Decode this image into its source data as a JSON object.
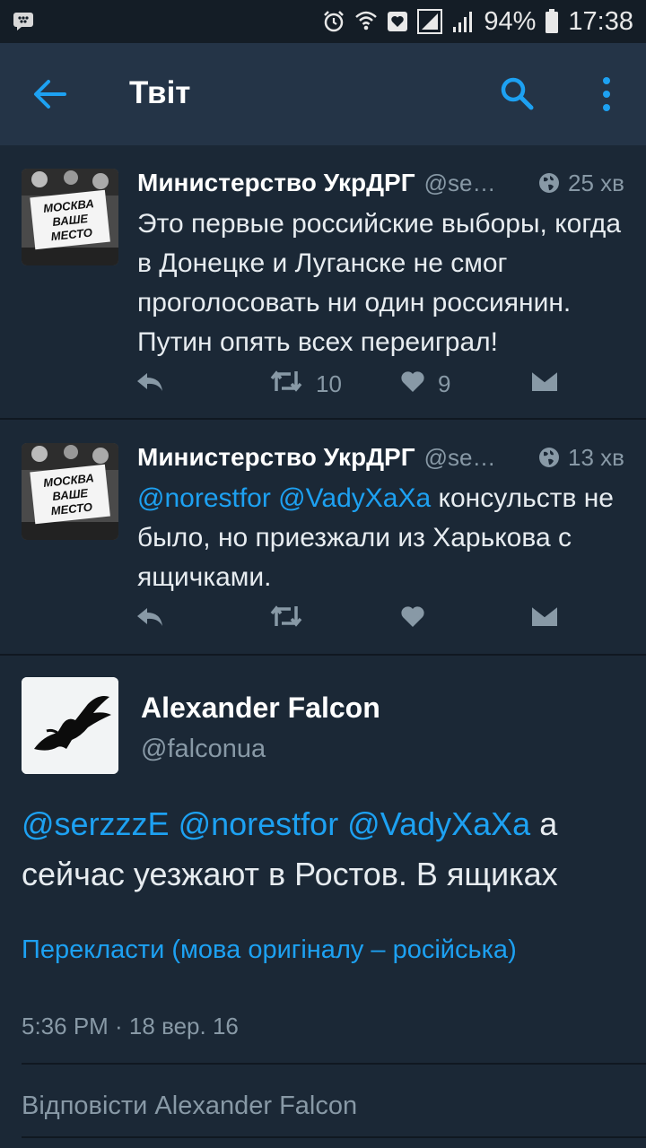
{
  "status_bar": {
    "battery": "94%",
    "time": "17:38",
    "icons": [
      "blackberry-messenger-icon",
      "alarm-icon",
      "wifi-icon",
      "heart-icon",
      "signal-icon",
      "signal-icon",
      "battery-icon"
    ]
  },
  "app_bar": {
    "title": "Твіт",
    "icons": [
      "back-arrow-icon",
      "search-icon",
      "more-vert-icon"
    ]
  },
  "tweets": [
    {
      "name": "Министерство УкрДРГ",
      "handle": "@se…",
      "time": "25 хв",
      "text": "Это первые российские выборы, когда в Донецке и Луганске не смог проголосовать ни один россиянин. Путин опять всех переиграл!",
      "retweets": "10",
      "likes": "9",
      "avatar_sign": [
        "МОСКВА",
        "ВАШЕ",
        "МЕСТО"
      ]
    },
    {
      "name": "Министерство УкрДРГ",
      "handle": "@se…",
      "time": "13 хв",
      "mentions": "@norestfor @VadyXaXa",
      "text": " консульств не было, но приезжали из Харькова с ящичками.",
      "retweets": "",
      "likes": "",
      "avatar_sign": [
        "МОСКВА",
        "ВАШЕ",
        "МЕСТО"
      ]
    }
  ],
  "main_tweet": {
    "name": "Alexander Falcon",
    "handle": "@falconua",
    "mentions": "@serzzzE @norestfor @VadyXaXa",
    "text": " а сейчас уезжают в Ростов. В ящиках",
    "translate": "Перекласти (мова оригіналу – російська)",
    "timestamp": "5:36 PM · 18 вер. 16",
    "reply_placeholder": "Відповісти Alexander Falcon"
  },
  "colors": {
    "background": "#1b2836",
    "app_bar": "#243447",
    "accent": "#1da1f2",
    "secondary_text": "#8899a6"
  }
}
